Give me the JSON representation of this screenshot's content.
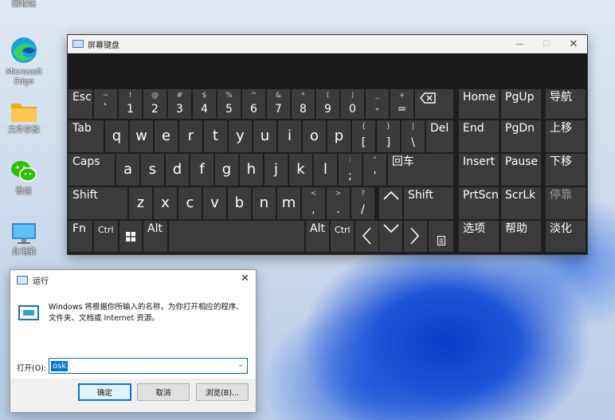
{
  "desktop": {
    "icons": [
      {
        "label": "回收站",
        "icon": "recycle-bin-icon"
      },
      {
        "label": "Microsoft Edge",
        "icon": "edge-icon"
      },
      {
        "label": "文件存放",
        "icon": "folder-icon"
      },
      {
        "label": "微信",
        "icon": "wechat-icon"
      },
      {
        "label": "此电脑",
        "icon": "computer-icon"
      }
    ]
  },
  "osk": {
    "title": "屏幕键盘",
    "controls": {
      "minimize": "—",
      "maximize": "☐",
      "close": "✕"
    },
    "row1": [
      {
        "top": "",
        "main": "Esc"
      },
      {
        "top": "~",
        "main": "`"
      },
      {
        "top": "!",
        "main": "1"
      },
      {
        "top": "@",
        "main": "2"
      },
      {
        "top": "#",
        "main": "3"
      },
      {
        "top": "$",
        "main": "4"
      },
      {
        "top": "%",
        "main": "5"
      },
      {
        "top": "^",
        "main": "6"
      },
      {
        "top": "&",
        "main": "7"
      },
      {
        "top": "*",
        "main": "8"
      },
      {
        "top": "(",
        "main": "9"
      },
      {
        "top": ")",
        "main": "0"
      },
      {
        "top": "_",
        "main": "-"
      },
      {
        "top": "+",
        "main": "="
      }
    ],
    "row2": [
      {
        "main": "Tab"
      },
      {
        "main": "q"
      },
      {
        "main": "w"
      },
      {
        "main": "e"
      },
      {
        "main": "r"
      },
      {
        "main": "t"
      },
      {
        "main": "y"
      },
      {
        "main": "u"
      },
      {
        "main": "i"
      },
      {
        "main": "o"
      },
      {
        "main": "p"
      },
      {
        "top": "{",
        "main": "["
      },
      {
        "top": "}",
        "main": "]"
      },
      {
        "top": "|",
        "main": "\\"
      },
      {
        "main": "Del"
      }
    ],
    "row3": [
      {
        "main": "Caps"
      },
      {
        "main": "a"
      },
      {
        "main": "s"
      },
      {
        "main": "d"
      },
      {
        "main": "f"
      },
      {
        "main": "g"
      },
      {
        "main": "h"
      },
      {
        "main": "j"
      },
      {
        "main": "k"
      },
      {
        "main": "l"
      },
      {
        "top": ":",
        "main": ";"
      },
      {
        "top": "\"",
        "main": "'"
      },
      {
        "main": "回车"
      }
    ],
    "row4": [
      {
        "main": "Shift"
      },
      {
        "main": "z"
      },
      {
        "main": "x"
      },
      {
        "main": "c"
      },
      {
        "main": "v"
      },
      {
        "main": "b"
      },
      {
        "main": "n"
      },
      {
        "main": "m"
      },
      {
        "top": "<",
        "main": ","
      },
      {
        "top": ">",
        "main": "."
      },
      {
        "top": "?",
        "main": "/"
      },
      {
        "main": "Shift"
      }
    ],
    "row5": [
      {
        "main": "Fn"
      },
      {
        "main": "Ctrl"
      },
      {
        "main": "Alt"
      },
      {
        "main": "Alt"
      },
      {
        "main": "Ctrl"
      }
    ],
    "nav": {
      "home": "Home",
      "pgup": "PgUp",
      "nav": "导航",
      "end": "End",
      "pgdn": "PgDn",
      "moveup": "上移",
      "insert": "Insert",
      "pause": "Pause",
      "movedown": "下移",
      "prtscn": "PrtScn",
      "scrlk": "ScrLk",
      "dock": "停靠",
      "options": "选项",
      "help": "帮助",
      "fade": "淡化"
    }
  },
  "run": {
    "title": "运行",
    "close": "✕",
    "description_line1": "Windows 将根据你所输入的名称，为你打开相应的程序、",
    "description_line2": "文件夹、文档或 Internet 资源。",
    "open_label": "打开(O):",
    "open_value": "osk",
    "dropdown": "⌄",
    "ok": "确定",
    "cancel": "取消",
    "browse": "浏览(B)..."
  }
}
